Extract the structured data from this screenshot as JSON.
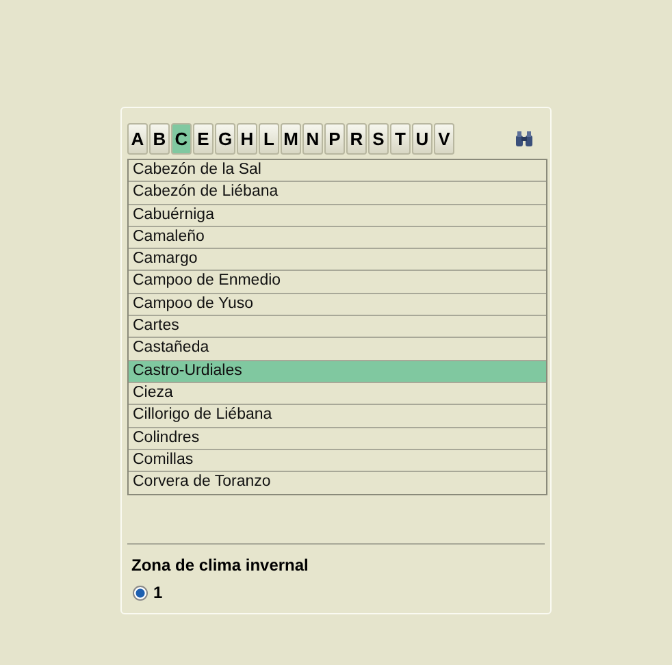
{
  "letters": [
    {
      "label": "A",
      "selected": false
    },
    {
      "label": "B",
      "selected": false
    },
    {
      "label": "C",
      "selected": true
    },
    {
      "label": "E",
      "selected": false
    },
    {
      "label": "G",
      "selected": false
    },
    {
      "label": "H",
      "selected": false
    },
    {
      "label": "L",
      "selected": false
    },
    {
      "label": "M",
      "selected": false
    },
    {
      "label": "N",
      "selected": false
    },
    {
      "label": "P",
      "selected": false
    },
    {
      "label": "R",
      "selected": false
    },
    {
      "label": "S",
      "selected": false
    },
    {
      "label": "T",
      "selected": false
    },
    {
      "label": "U",
      "selected": false
    },
    {
      "label": "V",
      "selected": false
    }
  ],
  "municipalities": [
    {
      "label": "Cabezón de la Sal",
      "selected": false
    },
    {
      "label": "Cabezón de Liébana",
      "selected": false
    },
    {
      "label": "Cabuérniga",
      "selected": false
    },
    {
      "label": "Camaleño",
      "selected": false
    },
    {
      "label": "Camargo",
      "selected": false
    },
    {
      "label": "Campoo de Enmedio",
      "selected": false
    },
    {
      "label": "Campoo de Yuso",
      "selected": false
    },
    {
      "label": "Cartes",
      "selected": false
    },
    {
      "label": "Castañeda",
      "selected": false
    },
    {
      "label": "Castro-Urdiales",
      "selected": true
    },
    {
      "label": "Cieza",
      "selected": false
    },
    {
      "label": "Cillorigo de Liébana",
      "selected": false
    },
    {
      "label": "Colindres",
      "selected": false
    },
    {
      "label": "Comillas",
      "selected": false
    },
    {
      "label": "Corvera de Toranzo",
      "selected": false
    }
  ],
  "climate_zone": {
    "title": "Zona de clima invernal",
    "options": [
      {
        "label": "1",
        "selected": true
      }
    ]
  }
}
